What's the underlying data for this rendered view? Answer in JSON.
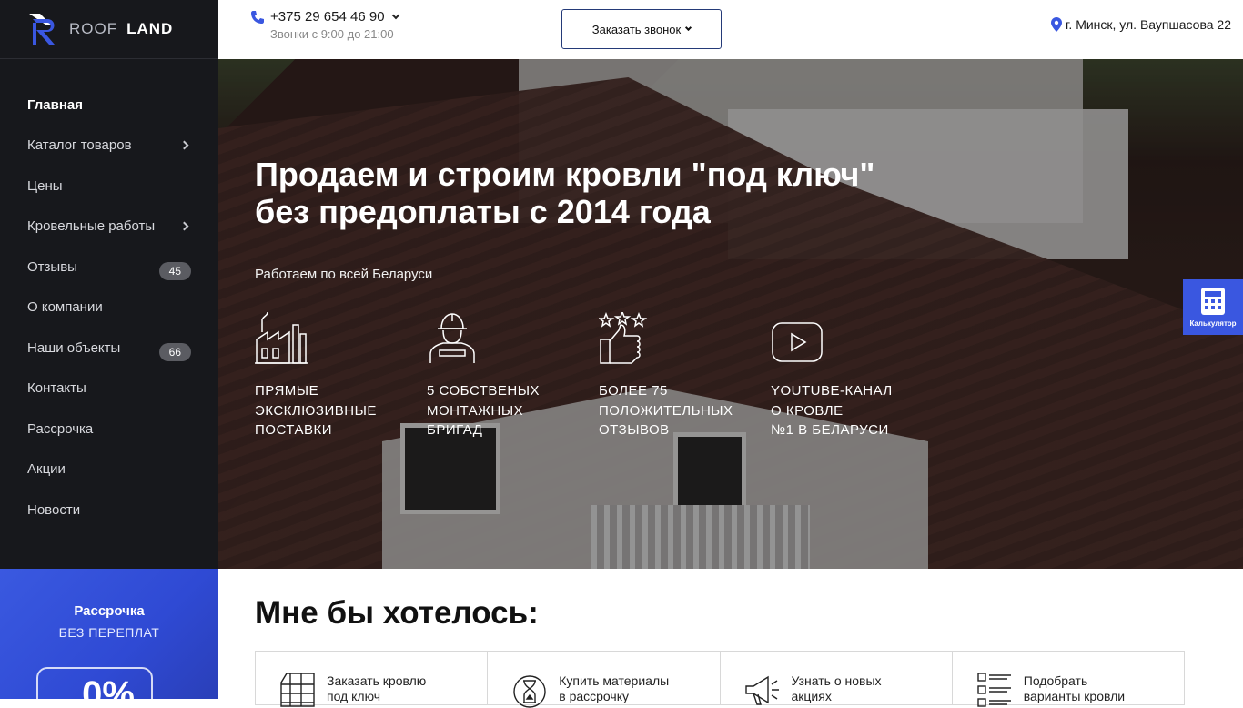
{
  "brand": {
    "word1": "ROOF",
    "word2": "LAND"
  },
  "sidebar": {
    "items": [
      {
        "label": "Главная",
        "active": true
      },
      {
        "label": "Каталог товаров",
        "submenu": true
      },
      {
        "label": "Цены"
      },
      {
        "label": "Кровельные работы",
        "submenu": true
      },
      {
        "label": "Отзывы",
        "badge": "45"
      },
      {
        "label": "О компании"
      },
      {
        "label": "Наши объекты",
        "badge": "66"
      },
      {
        "label": "Контакты"
      },
      {
        "label": "Рассрочка"
      },
      {
        "label": "Акции"
      },
      {
        "label": "Новости"
      }
    ]
  },
  "promo": {
    "title": "Рассрочка",
    "subtitle": "БЕЗ ПЕРЕПЛАТ",
    "value": "0%"
  },
  "header": {
    "phone": "+375 29 654 46 90",
    "hours": "Звонки с 9:00 до 21:00",
    "callback_label": "Заказать звонок",
    "address": "г. Минск, ул. Ваупшасова 22"
  },
  "hero": {
    "title_line1": "Продаем и строим кровли \"под ключ\"",
    "title_line2": "без предоплаты с 2014 года",
    "subtitle": "Работаем по всей Беларуси",
    "features": [
      {
        "icon": "factory-icon",
        "lines": [
          "ПРЯМЫЕ",
          "ЭКСКЛЮЗИВНЫЕ",
          "ПОСТАВКИ"
        ]
      },
      {
        "icon": "worker-icon",
        "lines": [
          "5 СОБСТВЕНЫХ",
          "МОНТАЖНЫХ",
          "БРИГАД"
        ]
      },
      {
        "icon": "thumbs-up-stars-icon",
        "lines": [
          "БОЛЕЕ 75",
          "ПОЛОЖИТЕЛЬНЫХ",
          "ОТЗЫВОВ"
        ]
      },
      {
        "icon": "youtube-icon",
        "lines": [
          "YOUTUBE-КАНАЛ",
          "О КРОВЛЕ",
          "№1 В БЕЛАРУСИ"
        ]
      }
    ]
  },
  "calculator": {
    "label": "Калькулятор"
  },
  "wish": {
    "title": "Мне бы хотелось:",
    "options": [
      {
        "icon": "roof-icon",
        "line1": "Заказать кровлю",
        "line2": "под ключ"
      },
      {
        "icon": "hourglass-icon",
        "line1": "Купить материалы",
        "line2": "в рассрочку"
      },
      {
        "icon": "megaphone-icon",
        "line1": "Узнать о новых",
        "line2": "акциях"
      },
      {
        "icon": "checklist-icon",
        "line1": "Подобрать",
        "line2": "варианты кровли"
      }
    ]
  },
  "colors": {
    "accent": "#3a57e0",
    "sidebar_bg": "#17181c",
    "callback_border": "#243a78"
  }
}
